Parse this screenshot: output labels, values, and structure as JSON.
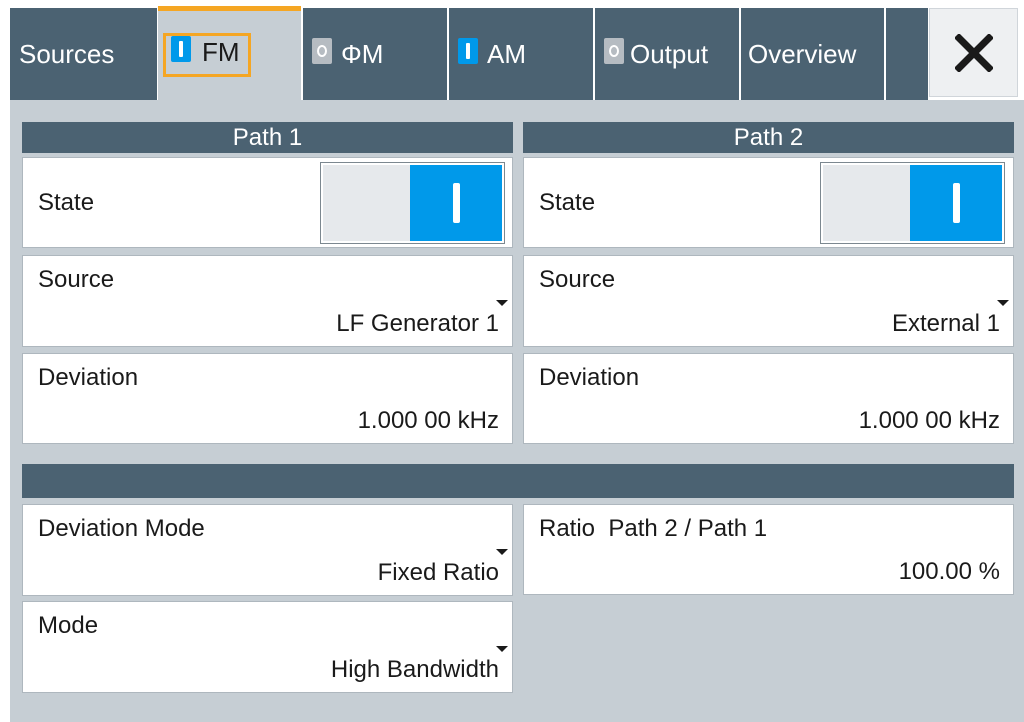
{
  "tabs": [
    {
      "label": "Sources",
      "indicator": null,
      "active": false
    },
    {
      "label": "FM",
      "indicator": "on",
      "active": true
    },
    {
      "label": "ΦM",
      "indicator": "off",
      "active": false
    },
    {
      "label": "AM",
      "indicator": "on",
      "active": false
    },
    {
      "label": "Output",
      "indicator": "off",
      "active": false
    },
    {
      "label": "Overview",
      "indicator": null,
      "active": false
    }
  ],
  "close_icon": "close-icon",
  "colors": {
    "header": "#4b6272",
    "accent": "#0099ea",
    "focus": "#f5a623",
    "panel_bg": "#c6ced4"
  },
  "path1": {
    "header": "Path 1",
    "state_label": "State",
    "state_on": true,
    "source_label": "Source",
    "source_value": "LF Generator 1",
    "deviation_label": "Deviation",
    "deviation_value": "1.000 00 kHz"
  },
  "path2": {
    "header": "Path 2",
    "state_label": "State",
    "state_on": true,
    "source_label": "Source",
    "source_value": "External 1",
    "deviation_label": "Deviation",
    "deviation_value": "1.000 00 kHz"
  },
  "common": {
    "deviation_mode_label": "Deviation Mode",
    "deviation_mode_value": "Fixed Ratio",
    "ratio_label": "Ratio  Path 2 / Path 1",
    "ratio_value": "100.00 %",
    "mode_label": "Mode",
    "mode_value": "High Bandwidth"
  }
}
